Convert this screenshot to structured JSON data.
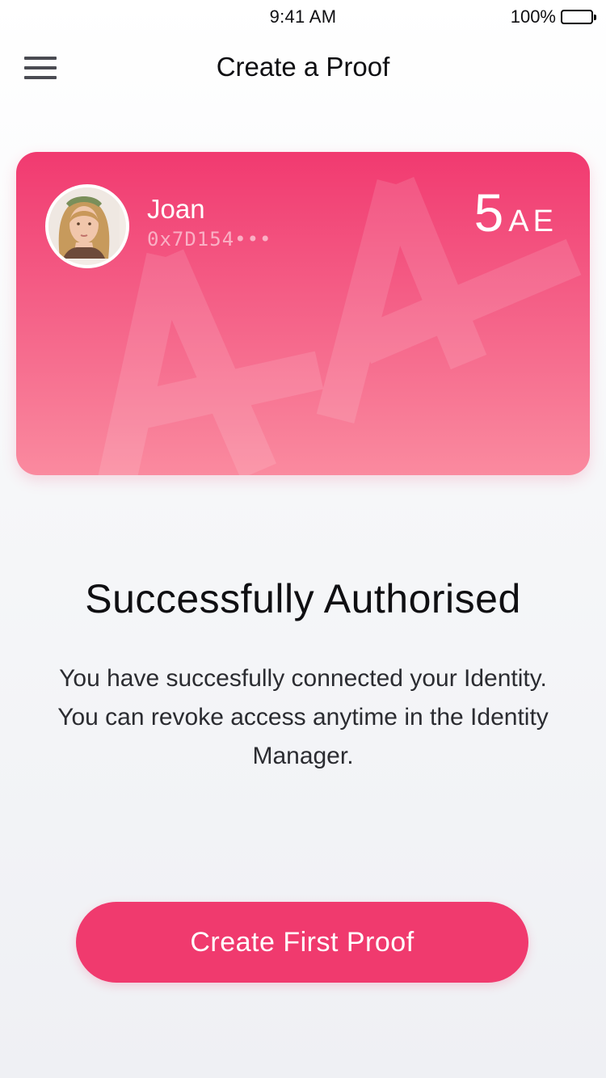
{
  "status_bar": {
    "time": "9:41 AM",
    "battery_percent": "100%",
    "battery_level": 1.0
  },
  "nav": {
    "title": "Create a Proof",
    "menu_icon": "hamburger-menu-icon"
  },
  "identity_card": {
    "name": "Joan",
    "address": "0x7D154•••",
    "balance_value": "5",
    "balance_unit": "AE",
    "gradient_top": "#f13a70",
    "gradient_bottom": "#fa8a9f"
  },
  "message": {
    "title": "Successfully Authorised",
    "body": "You have succesfully connected your Identity. You can revoke access anytime in the Identity Manager."
  },
  "cta": {
    "label": "Create First Proof",
    "color": "#f03a6e"
  }
}
